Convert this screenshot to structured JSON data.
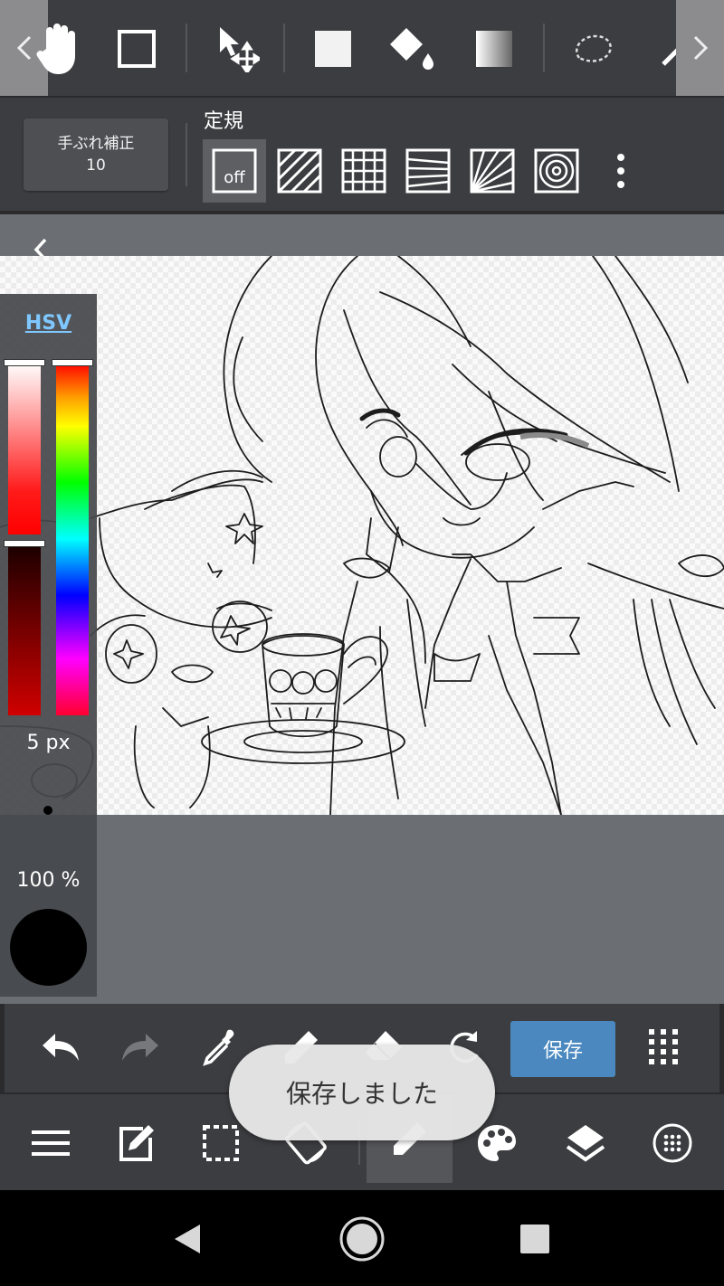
{
  "top_toolbar": {
    "tools": [
      {
        "name": "hand-tool",
        "active": true
      },
      {
        "name": "rectangle-select-tool"
      },
      {
        "name": "move-tool"
      },
      {
        "name": "fill-rect-tool"
      },
      {
        "name": "bucket-fill-tool"
      },
      {
        "name": "gradient-tool"
      },
      {
        "name": "lasso-tool"
      },
      {
        "name": "magic-wand-tool"
      }
    ]
  },
  "sub_toolbar": {
    "stabilizer_label": "手ぶれ補正",
    "stabilizer_value": "10",
    "ruler_title": "定規",
    "ruler_off_label": "off",
    "rulers": [
      "off",
      "parallel",
      "grid",
      "perspective-lines",
      "radial",
      "concentric"
    ]
  },
  "color_panel": {
    "mode_label": "HSV",
    "brush_size": "5 px",
    "opacity": "100 %",
    "current_color": "#000000",
    "saturation_level": 0.0,
    "value_level": 1.0,
    "hue_level": 0.0
  },
  "action_bar": {
    "save_label": "保存"
  },
  "toast": {
    "message": "保存しました"
  },
  "colors": {
    "toolbar_bg": "#3c3d40",
    "workspace_bg": "#6b6e73",
    "save_button": "#4a88bf",
    "hsv_link": "#7fc7ff"
  }
}
